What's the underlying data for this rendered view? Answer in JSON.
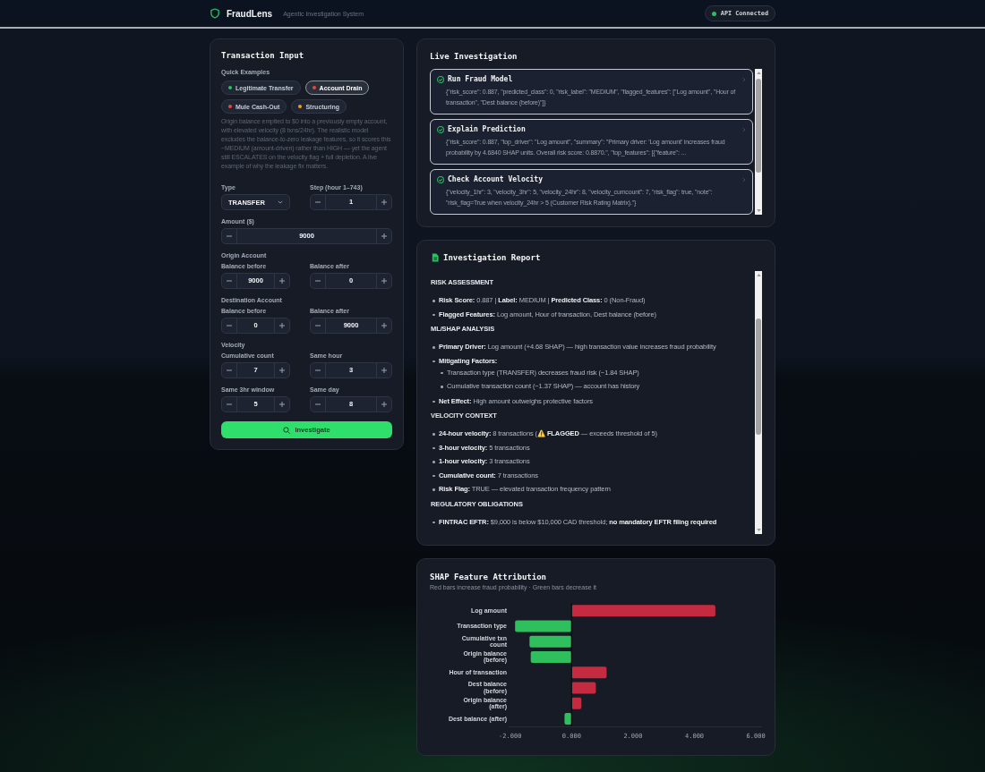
{
  "header": {
    "app_name": "FraudLens",
    "tagline": "Agentic Investigation System",
    "api_status": "API Connected"
  },
  "transaction_input": {
    "title": "Transaction Input",
    "quick_examples_label": "Quick Examples",
    "quick_examples": [
      {
        "label": "Legitimate Transfer",
        "color": "#22c55e",
        "selected": false
      },
      {
        "label": "Account Drain",
        "color": "#ef4444",
        "selected": true
      },
      {
        "label": "Mule Cash-Out",
        "color": "#ef4444",
        "selected": false
      },
      {
        "label": "Structuring",
        "color": "#f59e0b",
        "selected": false
      }
    ],
    "description": "Origin balance emptied to $0 into a previously empty account, with elevated velocity (8 txns/24hr). The realistic model excludes the balance-to-zero leakage features, so it scores this ~MEDIUM (amount-driven) rather than HIGH — yet the agent still ESCALATES on the velocity flag + full depletion. A live example of why the leakage fix matters.",
    "rows": [
      {
        "fields": [
          {
            "kind": "select",
            "label": "Type",
            "value": "TRANSFER"
          },
          {
            "kind": "stepper",
            "label": "Step (hour 1–743)",
            "value": "1"
          }
        ]
      },
      {
        "fields": [
          {
            "kind": "stepper",
            "label": "Amount ($)",
            "value": "9000"
          }
        ]
      },
      {
        "heading": "Origin Account",
        "fields": [
          {
            "kind": "stepper",
            "label": "Balance before",
            "value": "9000"
          },
          {
            "kind": "stepper",
            "label": "Balance after",
            "value": "0"
          }
        ]
      },
      {
        "heading": "Destination Account",
        "fields": [
          {
            "kind": "stepper",
            "label": "Balance before",
            "value": "0"
          },
          {
            "kind": "stepper",
            "label": "Balance after",
            "value": "9000"
          }
        ]
      },
      {
        "heading": "Velocity",
        "fields": [
          {
            "kind": "stepper",
            "label": "Cumulative count",
            "value": "7"
          },
          {
            "kind": "stepper",
            "label": "Same hour",
            "value": "3"
          }
        ]
      },
      {
        "fields": [
          {
            "kind": "stepper",
            "label": "Same 3hr window",
            "value": "5"
          },
          {
            "kind": "stepper",
            "label": "Same day",
            "value": "8"
          }
        ]
      }
    ],
    "button": "Investigate"
  },
  "live_investigation": {
    "title": "Live Investigation",
    "steps": [
      {
        "title": "Run Fraud Model",
        "completed": true,
        "output": "{\"risk_score\": 0.887, \"predicted_class\": 0, \"risk_label\": \"MEDIUM\", \"flagged_features\": [\"Log amount\", \"Hour of transaction\", \"Dest balance (before)\"]}"
      },
      {
        "title": "Explain Prediction",
        "completed": true,
        "output": "{\"risk_score\": 0.887, \"top_driver\": \"Log amount\", \"summary\": \"Primary driver: 'Log amount' increases fraud probability by 4.6840 SHAP units. Overall risk score: 0.8870.\", \"top_features\": [{\"feature\": ..."
      },
      {
        "title": "Check Account Velocity",
        "completed": true,
        "output": "{\"velocity_1hr\": 3, \"velocity_3hr\": 5, \"velocity_24hr\": 8, \"velocity_cumcount\": 7, \"risk_flag\": true, \"note\": \"risk_flag=True when velocity_24hr > 5 (Customer Risk Rating Matrix).\"}"
      }
    ]
  },
  "investigation_report": {
    "title": "Investigation Report",
    "sections": [
      {
        "heading": "RISK ASSESSMENT",
        "items": [
          {
            "text": "**Risk Score:** 0.887 | **Label:** MEDIUM | **Predicted Class:** 0 (Non-Fraud)"
          },
          {
            "text": "**Flagged Features:** Log amount, Hour of transaction, Dest balance (before)"
          }
        ]
      },
      {
        "heading": "ML/SHAP ANALYSIS",
        "items": [
          {
            "text": "**Primary Driver:** Log amount (+4.68 SHAP) — high transaction value increases fraud probability"
          },
          {
            "text": "**Mitigating Factors:**",
            "children": [
              {
                "text": "Transaction type (TRANSFER) decreases fraud risk (−1.84 SHAP)"
              },
              {
                "text": "Cumulative transaction count (−1.37 SHAP) — account has history"
              }
            ]
          },
          {
            "text": "**Net Effect:** High amount outweighs protective factors"
          }
        ]
      },
      {
        "heading": "VELOCITY CONTEXT",
        "items": [
          {
            "text": "**24-hour velocity:** 8 transactions (⚠️ **FLAGGED** — exceeds threshold of 5)"
          },
          {
            "text": "**3-hour velocity:** 5 transactions"
          },
          {
            "text": "**1-hour velocity:** 3 transactions"
          },
          {
            "text": "**Cumulative count:** 7 transactions"
          },
          {
            "text": "**Risk Flag:** TRUE — elevated transaction frequency pattern"
          }
        ]
      },
      {
        "heading": "REGULATORY OBLIGATIONS",
        "items": [
          {
            "text": "**FINTRAC EFTR:** $9,000 is below $10,000 CAD threshold; **no mandatory EFTR filing required**"
          }
        ]
      }
    ]
  },
  "shap_attribution": {
    "subtitle": "Red bars increase fraud probability · Green bars decrease it",
    "chart_data": {
      "type": "bar",
      "orientation": "horizontal",
      "title": "SHAP Feature Attribution",
      "categories": [
        "Log amount",
        "Transaction type",
        "Cumulative txn count",
        "Origin balance (before)",
        "Hour of transaction",
        "Dest balance (before)",
        "Origin balance (after)",
        "Dest balance (after)"
      ],
      "values": [
        4.68,
        -1.84,
        -1.37,
        -1.33,
        1.14,
        0.79,
        0.32,
        -0.23
      ],
      "xlim": [
        -2.05,
        6.2
      ],
      "xticks": [
        {
          "value": -2,
          "label": "-2.000"
        },
        {
          "value": 0,
          "label": "0.000"
        },
        {
          "value": 2,
          "label": "2.000"
        },
        {
          "value": 4,
          "label": "4.000"
        },
        {
          "value": 6,
          "label": "6.000"
        }
      ]
    }
  }
}
